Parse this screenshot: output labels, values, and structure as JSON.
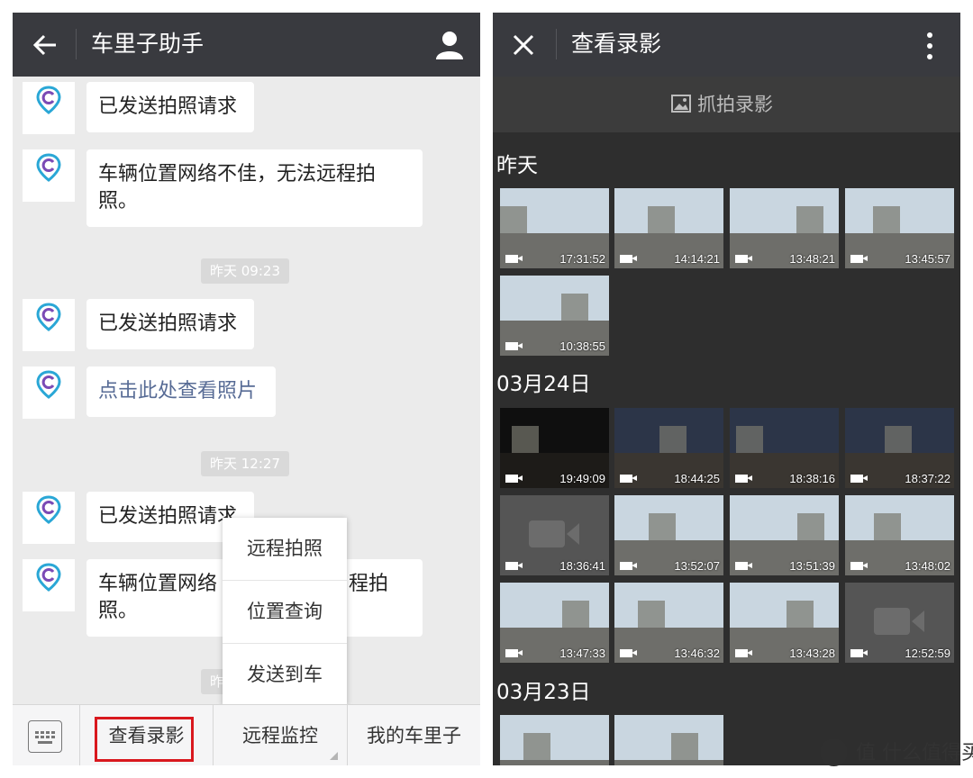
{
  "left": {
    "header": {
      "title": "车里子助手"
    },
    "avatar_brand": "cneeds",
    "messages": [
      {
        "text": "已发送拍照请求"
      },
      {
        "text": "车辆位置网络不佳，无法远程拍照。",
        "line1": "车辆位置网络不佳，无法远程拍",
        "line2": "照。"
      },
      {
        "text": "已发送拍照请求"
      },
      {
        "text": "点击此处查看照片"
      },
      {
        "text": "已发送拍照请求"
      },
      {
        "line1": "车辆位置网络",
        "line1b": "程拍",
        "line2": "照。"
      }
    ],
    "timestamps": [
      "昨天 09:23",
      "昨天 12:27",
      "昨"
    ],
    "popup_menu": [
      "远程拍照",
      "位置查询",
      "发送到车"
    ],
    "bottom_tabs": [
      "查看录影",
      "远程监控",
      "我的车里子"
    ]
  },
  "right": {
    "header": {
      "title": "查看录影"
    },
    "capture_label": "抓拍录影",
    "groups": [
      {
        "title": "昨天",
        "items": [
          "17:31:52",
          "14:14:21",
          "13:48:21",
          "13:45:57",
          "10:38:55"
        ]
      },
      {
        "title": "03月24日",
        "items": [
          "19:49:09",
          "18:44:25",
          "18:38:16",
          "18:37:22",
          "18:36:41",
          "13:52:07",
          "13:51:39",
          "13:48:02",
          "13:47:33",
          "13:46:32",
          "13:43:28",
          "12:52:59"
        ]
      },
      {
        "title": "03月23日",
        "items": [
          "",
          ""
        ]
      }
    ]
  },
  "watermark": "值 什么值得买",
  "colors": {
    "header_bg": "#393a3f",
    "chat_bg": "#ebebeb",
    "gallery_bg": "#2e2e2e",
    "highlight": "#d9181e",
    "link": "#576b95"
  }
}
